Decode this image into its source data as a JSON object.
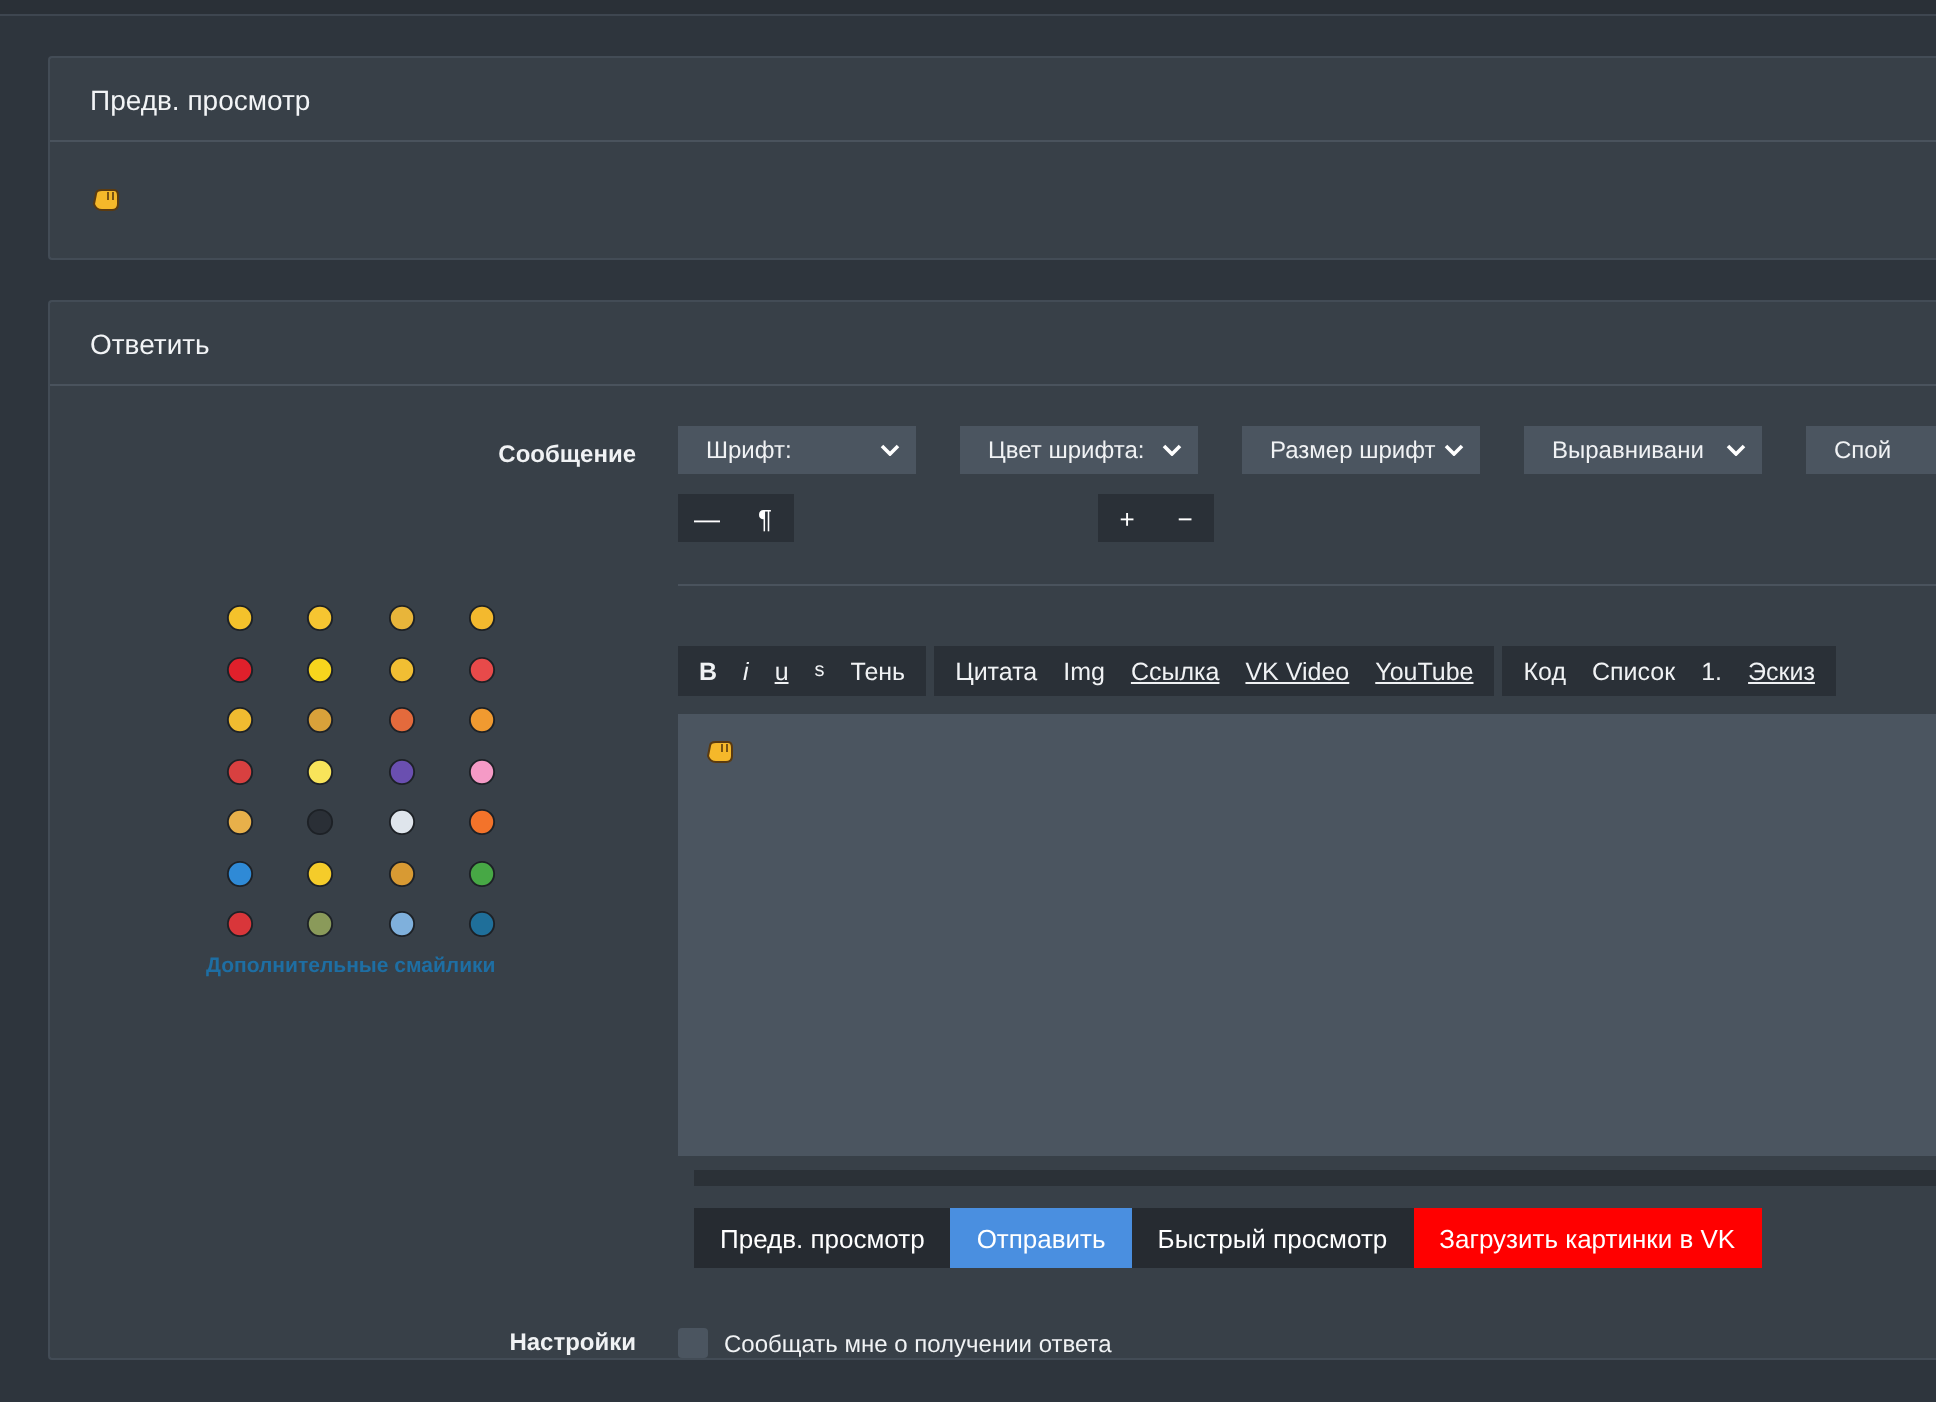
{
  "preview_panel": {
    "title": "Предв. просмотр"
  },
  "reply_panel": {
    "title": "Ответить",
    "message_label": "Сообщение",
    "dropdowns": [
      "Шрифт:",
      "Цвет шрифта:",
      "Размер шрифт",
      "Выравнивани"
    ],
    "edge_dropdown": "Спой",
    "small_button_groups": [
      [
        "—",
        "¶"
      ],
      [
        "+",
        "−"
      ]
    ],
    "toolbar_groups": [
      [
        {
          "label": "B",
          "kind": "bold"
        },
        {
          "label": "i",
          "kind": "italic"
        },
        {
          "label": "u",
          "kind": "underline"
        },
        {
          "label": "s",
          "kind": "small"
        },
        {
          "label": "Тень",
          "kind": "plain"
        }
      ],
      [
        {
          "label": "Цитата",
          "kind": "plain"
        },
        {
          "label": "Img",
          "kind": "plain"
        },
        {
          "label": "Ссылка",
          "kind": "underline"
        },
        {
          "label": "VK Video",
          "kind": "underline"
        },
        {
          "label": "YouTube",
          "kind": "underline"
        }
      ],
      [
        {
          "label": "Код",
          "kind": "plain"
        },
        {
          "label": "Список",
          "kind": "plain"
        },
        {
          "label": "1.",
          "kind": "plain"
        },
        {
          "label": "Эскиз",
          "kind": "underline"
        }
      ]
    ],
    "smileys": [
      {
        "color": "#f4c22b"
      },
      {
        "color": "#f6c531"
      },
      {
        "color": "#e8b53a"
      },
      {
        "color": "#f3b92e"
      },
      {
        "color": "#e0202b"
      },
      {
        "color": "#f7d51d"
      },
      {
        "color": "#f1be33"
      },
      {
        "color": "#e84a4a"
      },
      {
        "color": "#f0bb30"
      },
      {
        "color": "#d9a13a"
      },
      {
        "color": "#e46a3c"
      },
      {
        "color": "#f09a30"
      },
      {
        "color": "#d84040"
      },
      {
        "color": "#f8e45a"
      },
      {
        "color": "#6a4fb0"
      },
      {
        "color": "#f59ac6"
      },
      {
        "color": "#e8b04a"
      },
      {
        "color": "#2a2f36"
      },
      {
        "color": "#dfe5ec"
      },
      {
        "color": "#f3732a"
      },
      {
        "color": "#2f8ad6"
      },
      {
        "color": "#f5cc2a"
      },
      {
        "color": "#d89a33"
      },
      {
        "color": "#47a845"
      },
      {
        "color": "#d9363a"
      },
      {
        "color": "#8a9a5a"
      },
      {
        "color": "#7fb0dc"
      },
      {
        "color": "#1f6f9a"
      }
    ],
    "more_smileys_link": "Дополнительные смайлики",
    "buttons": [
      {
        "label": "Предв. просмотр",
        "kind": "dark"
      },
      {
        "label": "Отправить",
        "kind": "primary"
      },
      {
        "label": "Быстрый просмотр",
        "kind": "dark"
      },
      {
        "label": "Загрузить картинки в VK",
        "kind": "danger"
      }
    ],
    "settings_label": "Настройки",
    "notify_checkbox": {
      "label": "Сообщать мне о получении ответа",
      "checked": false
    }
  }
}
